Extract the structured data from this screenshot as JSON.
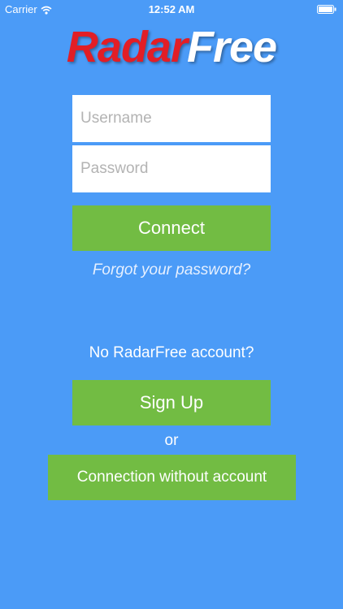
{
  "status_bar": {
    "carrier": "Carrier",
    "time": "12:52 AM",
    "wifi_icon": "wifi-icon",
    "battery_icon": "battery-icon"
  },
  "logo": {
    "part1": "Radar",
    "part2": "Free",
    "part1_color": "#e21e26",
    "part2_color": "#ffffff"
  },
  "form": {
    "username_placeholder": "Username",
    "username_value": "",
    "password_placeholder": "Password",
    "password_value": "",
    "connect_label": "Connect",
    "forgot_label": "Forgot your password?"
  },
  "signup": {
    "prompt": "No RadarFree account?",
    "signup_label": "Sign Up",
    "or_label": "or",
    "guest_label": "Connection without account"
  },
  "colors": {
    "background": "#4b9bf7",
    "button": "#72bc43",
    "text": "#ffffff"
  }
}
